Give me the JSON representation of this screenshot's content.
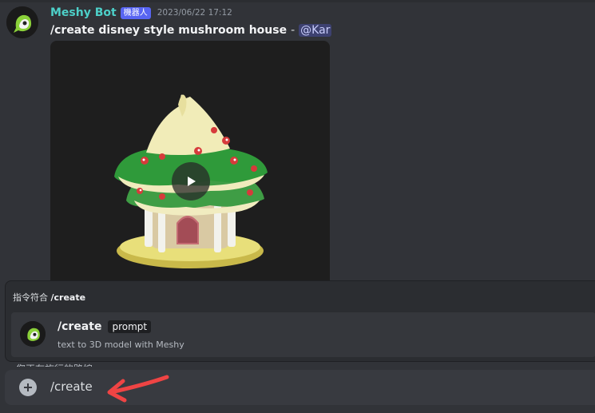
{
  "message": {
    "username": "Meshy Bot",
    "bot_badge": "機器人",
    "timestamp": "2023/06/22 17:12",
    "command": "/create disney style mushroom house",
    "separator": "-",
    "mention": "@Kar"
  },
  "autocomplete": {
    "header_prefix": "指令符合",
    "header_command": "/create",
    "suggestion": {
      "name": "/create",
      "option": "prompt",
      "description": "text to 3D model with Meshy"
    }
  },
  "obscured_text": "您正在旅行的路線",
  "input": {
    "value": "/create"
  },
  "icons": {
    "avatar": "meshy-bot-avatar-icon",
    "play": "play-icon",
    "plus": "plus-circle-icon",
    "arrow": "red-arrow-annotation-icon"
  },
  "colors": {
    "username": "#4dd0c9",
    "bot_badge": "#5865f2",
    "annotation_arrow": "#ef4444"
  }
}
